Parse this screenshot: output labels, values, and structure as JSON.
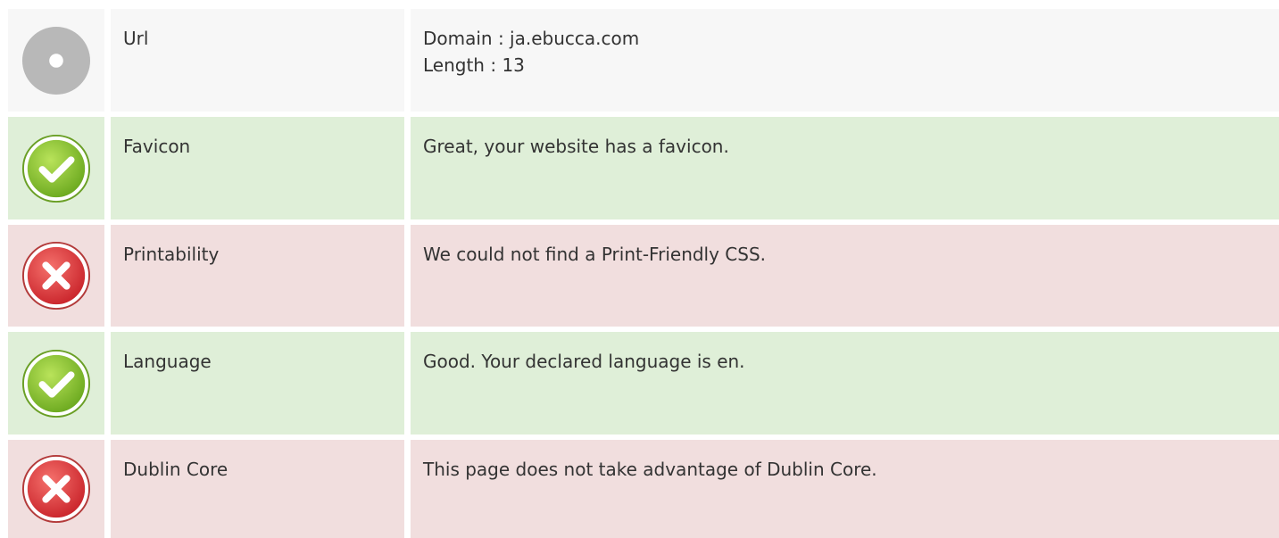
{
  "rows": [
    {
      "status": "neutral",
      "icon": "info-icon",
      "label": "Url",
      "lines": [
        "Domain : ja.ebucca.com",
        "Length : 13"
      ]
    },
    {
      "status": "pass",
      "icon": "check-icon",
      "label": "Favicon",
      "lines": [
        "Great, your website has a favicon."
      ]
    },
    {
      "status": "fail",
      "icon": "cross-icon",
      "label": "Printability",
      "lines": [
        "We could not find a Print-Friendly CSS."
      ]
    },
    {
      "status": "pass",
      "icon": "check-icon",
      "label": "Language",
      "lines": [
        "Good. Your declared language is en."
      ]
    },
    {
      "status": "fail",
      "icon": "cross-icon",
      "label": "Dublin Core",
      "lines": [
        "This page does not take advantage of Dublin Core."
      ]
    }
  ],
  "colors": {
    "neutral_bg": "#f7f7f7",
    "pass_bg": "#dfefd8",
    "fail_bg": "#f1dede",
    "pass_icon": "#7cbf2a",
    "fail_icon": "#e0383a",
    "neutral_icon": "#b8b8b8"
  }
}
